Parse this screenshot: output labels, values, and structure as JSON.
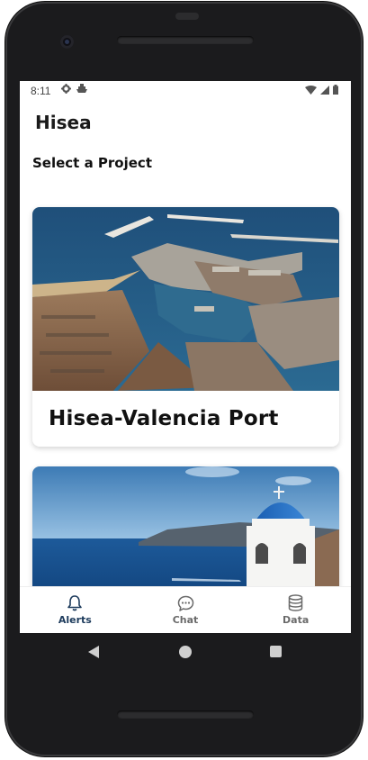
{
  "status_bar": {
    "time": "8:11",
    "left_icons": [
      "gear-icon",
      "ship-icon"
    ],
    "right_icons": [
      "wifi-icon",
      "signal-icon",
      "battery-icon"
    ]
  },
  "app": {
    "title": "Hisea",
    "section_title": "Select a Project"
  },
  "projects": [
    {
      "name": "Hisea-Valencia Port",
      "image": "aerial view of Valencia port"
    },
    {
      "name": "",
      "image": "blue-domed church overlooking the sea (Santorini)"
    }
  ],
  "tabs": [
    {
      "label": "Alerts",
      "icon": "bell-icon",
      "active": true
    },
    {
      "label": "Chat",
      "icon": "chat-bubble-icon",
      "active": false
    },
    {
      "label": "Data",
      "icon": "database-icon",
      "active": false
    }
  ],
  "nav_buttons": [
    "back-icon",
    "home-icon",
    "recents-icon"
  ],
  "colors": {
    "active_tab": "#1d3b5c",
    "inactive_tab": "#6a6a6a",
    "frame": "#1b1b1d"
  }
}
